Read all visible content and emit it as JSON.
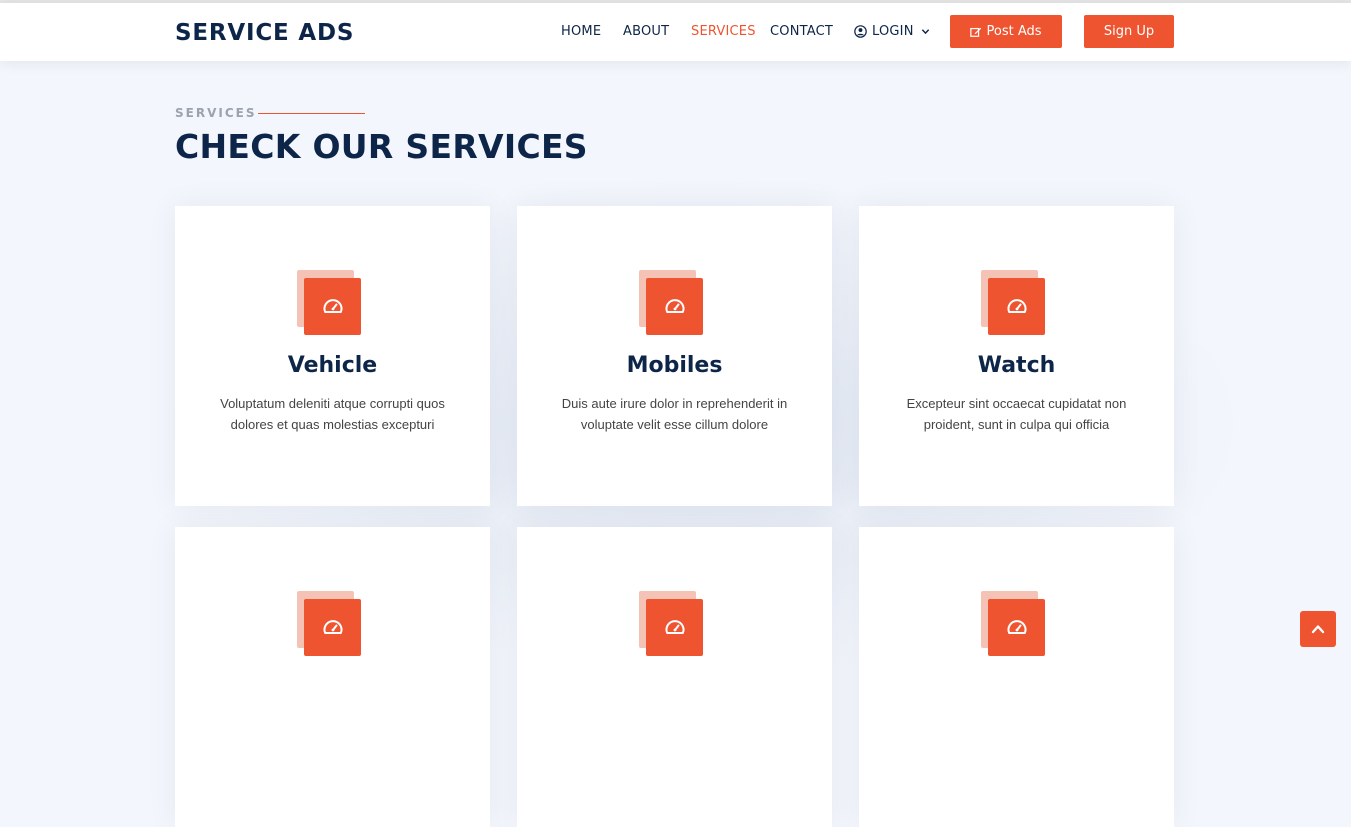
{
  "header": {
    "logo": "SERVICE ADS",
    "nav": {
      "home": "HOME",
      "about": "ABOUT",
      "services": "SERVICES",
      "contact": "CONTACT",
      "login": "LOGIN"
    },
    "post_ads": "Post Ads",
    "sign_up": "Sign Up"
  },
  "section": {
    "label": "SERVICES",
    "title": "CHECK OUR SERVICES"
  },
  "cards": [
    {
      "title": "Vehicle",
      "desc": "Voluptatum deleniti atque corrupti quos dolores et quas molestias excepturi",
      "icon": "speedometer-icon"
    },
    {
      "title": "Mobiles",
      "desc": "Duis aute irure dolor in reprehenderit in voluptate velit esse cillum dolore",
      "icon": "speedometer-icon"
    },
    {
      "title": "Watch",
      "desc": "Excepteur sint occaecat cupidatat non proident, sunt in culpa qui officia",
      "icon": "speedometer-icon"
    },
    {
      "title": "",
      "desc": "",
      "icon": "speedometer-icon"
    },
    {
      "title": "",
      "desc": "",
      "icon": "speedometer-icon"
    },
    {
      "title": "",
      "desc": "",
      "icon": "speedometer-icon"
    }
  ],
  "colors": {
    "accent": "#ef5430",
    "accent_light": "#f5c3b6",
    "navy": "#0d2548",
    "background": "#f3f6fc"
  },
  "scroll_top_icon": "chevron-up-icon"
}
